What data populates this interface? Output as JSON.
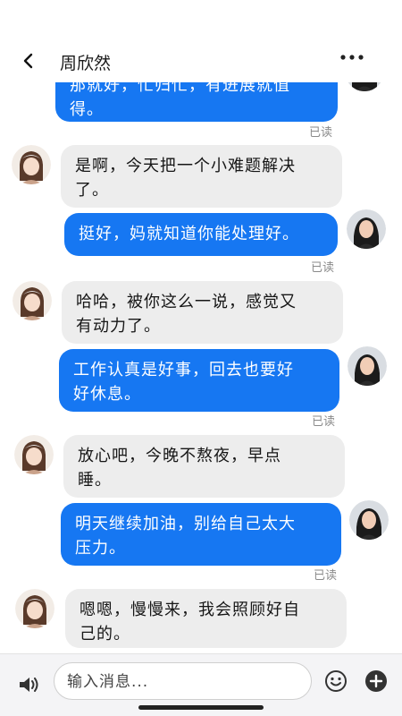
{
  "header": {
    "contact_name": "周欣然"
  },
  "messages": [
    {
      "from": "mom",
      "text_line1": "那就好，likely cropped",
      "text": "那就好，忙归忙，有进展就值得。",
      "visible_line": "得。"
    },
    {
      "from": "daughter",
      "text": "是啊，今天把一个小难题解决了。"
    },
    {
      "from": "mom",
      "text": "挺好，妈就知道你能处理好。"
    },
    {
      "from": "daughter",
      "text": "哈哈，被你这么一说，感觉又有动力了。"
    },
    {
      "from": "mom",
      "text": "工作认真是好事，回去也要好好休息。"
    },
    {
      "from": "daughter",
      "text": "放心吧，今晚不熬夜，早点睡。"
    },
    {
      "from": "mom",
      "text": "明天继续加油，别给自己太大压力。"
    },
    {
      "from": "daughter",
      "text": "嗯嗯，慢慢来，我会照顾好自己的。"
    }
  ],
  "lines": {
    "m0_l1": "那就好，忙归忙，有进展就值",
    "m0_l2": "得。",
    "m1_l1": "是啊，今天把一个小难题解决",
    "m1_l2": "了。",
    "m2_l1": "挺好，妈就知道你能处理好。",
    "m3_l1": "哈哈，被你这么一说，感觉又",
    "m3_l2": "有动力了。",
    "m4_l1": "工作认真是好事，回去也要好",
    "m4_l2": "好休息。",
    "m5_l1": "放心吧，今晚不熬夜，早点",
    "m5_l2": "睡。",
    "m6_l1": "明天继续加油，别给自己太大",
    "m6_l2": "压力。",
    "m7_l1": "嗯嗯，慢慢来，我会照顾好自",
    "m7_l2": "己的。"
  },
  "read_label": "已读",
  "input": {
    "placeholder": "输入消息..."
  },
  "colors": {
    "outgoing_bubble": "#1677f2",
    "incoming_bubble": "#ededed",
    "read_text": "#8a8a8a"
  },
  "icons": [
    "back-arrow-icon",
    "more-dots-icon",
    "voice-icon",
    "emoji-icon",
    "plus-icon"
  ]
}
